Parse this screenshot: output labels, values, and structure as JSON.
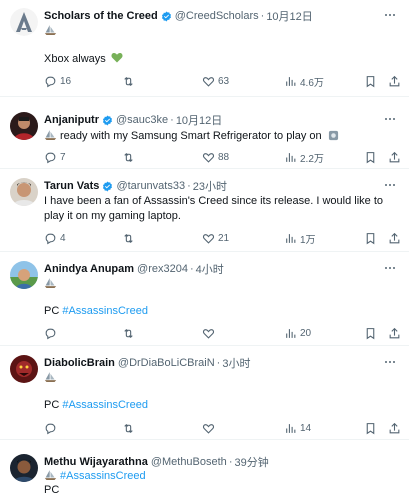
{
  "posts": [
    {
      "name": "Scholars of the Creed",
      "handle": "@CreedScholars",
      "time": "10月12日",
      "text": "Xbox always",
      "reply_count": "16",
      "retweet_count": "",
      "like_count": "63",
      "view_count": "4.6万"
    },
    {
      "name": "Anjaniputr",
      "handle": "@sauc3ke",
      "time": "10月12日",
      "text": "ready with my Samsung Smart Refrigerator to play on",
      "reply_count": "7",
      "retweet_count": "",
      "like_count": "88",
      "view_count": "2.2万"
    },
    {
      "name": "Tarun Vats",
      "handle": "@tarunvats33",
      "time": "23小时",
      "text": "I have been a fan of Assassin's Creed since its release. I would like to play it on my gaming laptop.",
      "reply_count": "4",
      "retweet_count": "",
      "like_count": "21",
      "view_count": "1万"
    },
    {
      "name": "Anindya Anupam",
      "handle": "@rex3204",
      "time": "4小时",
      "text_prefix": "PC",
      "hashtag": "#AssassinsCreed",
      "reply_count": "",
      "retweet_count": "",
      "like_count": "",
      "view_count": "20"
    },
    {
      "name": "DiabolicBrain",
      "handle": "@DrDiaBoLiCBraiN",
      "time": "3小时",
      "text_prefix": "PC",
      "hashtag": "#AssassinsCreed",
      "reply_count": "",
      "retweet_count": "",
      "like_count": "",
      "view_count": "14"
    },
    {
      "name": "Methu Wijayarathna",
      "handle": "@MethuBoseth",
      "time": "39分钟",
      "hashtag": "#AssassinsCreed",
      "text_suffix": "PC"
    }
  ],
  "dot": "·",
  "colors": {
    "accent": "#1d9bf0",
    "muted": "#536471",
    "heart_emoji": "#78b159"
  }
}
